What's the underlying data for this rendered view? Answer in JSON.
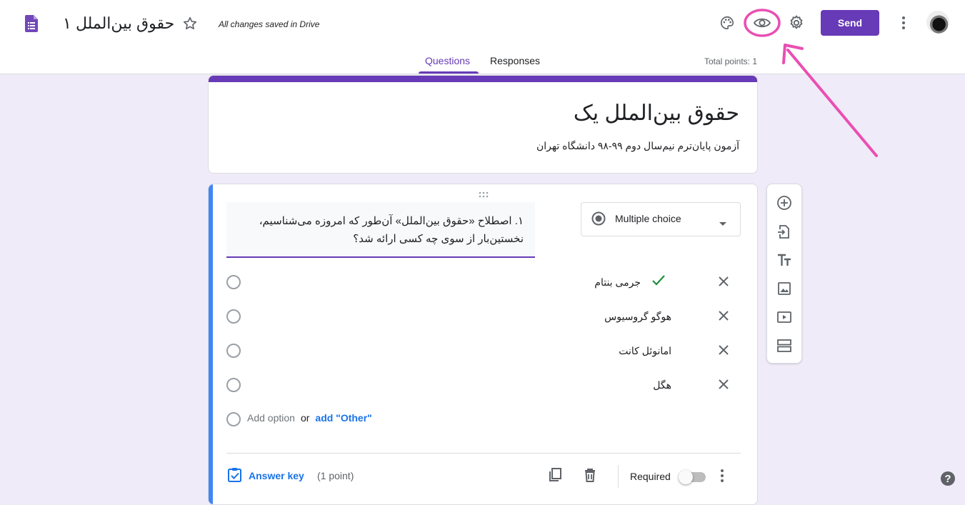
{
  "header": {
    "doc_title": "حقوق بین‌الملل ۱",
    "save_status": "All changes saved in Drive",
    "send_label": "Send",
    "icons": [
      "forms-logo-icon",
      "star-icon",
      "palette-icon",
      "eye-preview-icon",
      "gear-icon",
      "more-vert-icon",
      "avatar"
    ]
  },
  "tabs": [
    {
      "label": "Questions",
      "active": true
    },
    {
      "label": "Responses",
      "active": false
    }
  ],
  "total_points": "Total points: 1",
  "form": {
    "title": "حقوق بین‌الملل یک",
    "description": "آزمون پایان‌ترم نیم‌سال دوم ۹۹-۹۸ دانشگاه تهران"
  },
  "question": {
    "text_line1": "۱. اصطلاح «حقوق بین‌الملل» آن‌طور که امروزه می‌شناسیم،",
    "text_line2": "نخستین‌بار از سوی چه کسی ارائه شد؟",
    "type_label": "Multiple choice",
    "options": [
      {
        "label": "جرمی بنتام",
        "correct": true
      },
      {
        "label": "هوگو گروسیوس",
        "correct": false
      },
      {
        "label": "امانوئل کانت",
        "correct": false
      },
      {
        "label": "هگل",
        "correct": false
      }
    ],
    "add_option": "Add option",
    "or_text": "or",
    "add_other": "add \"Other\"",
    "answer_key": "Answer key",
    "points": "(1 point)",
    "required_label": "Required"
  },
  "colors": {
    "accent": "#673ab7",
    "background": "#f0ebf8",
    "link": "#1a73e8",
    "correct": "#1e8e3e",
    "annotation": "#e94fb3"
  }
}
